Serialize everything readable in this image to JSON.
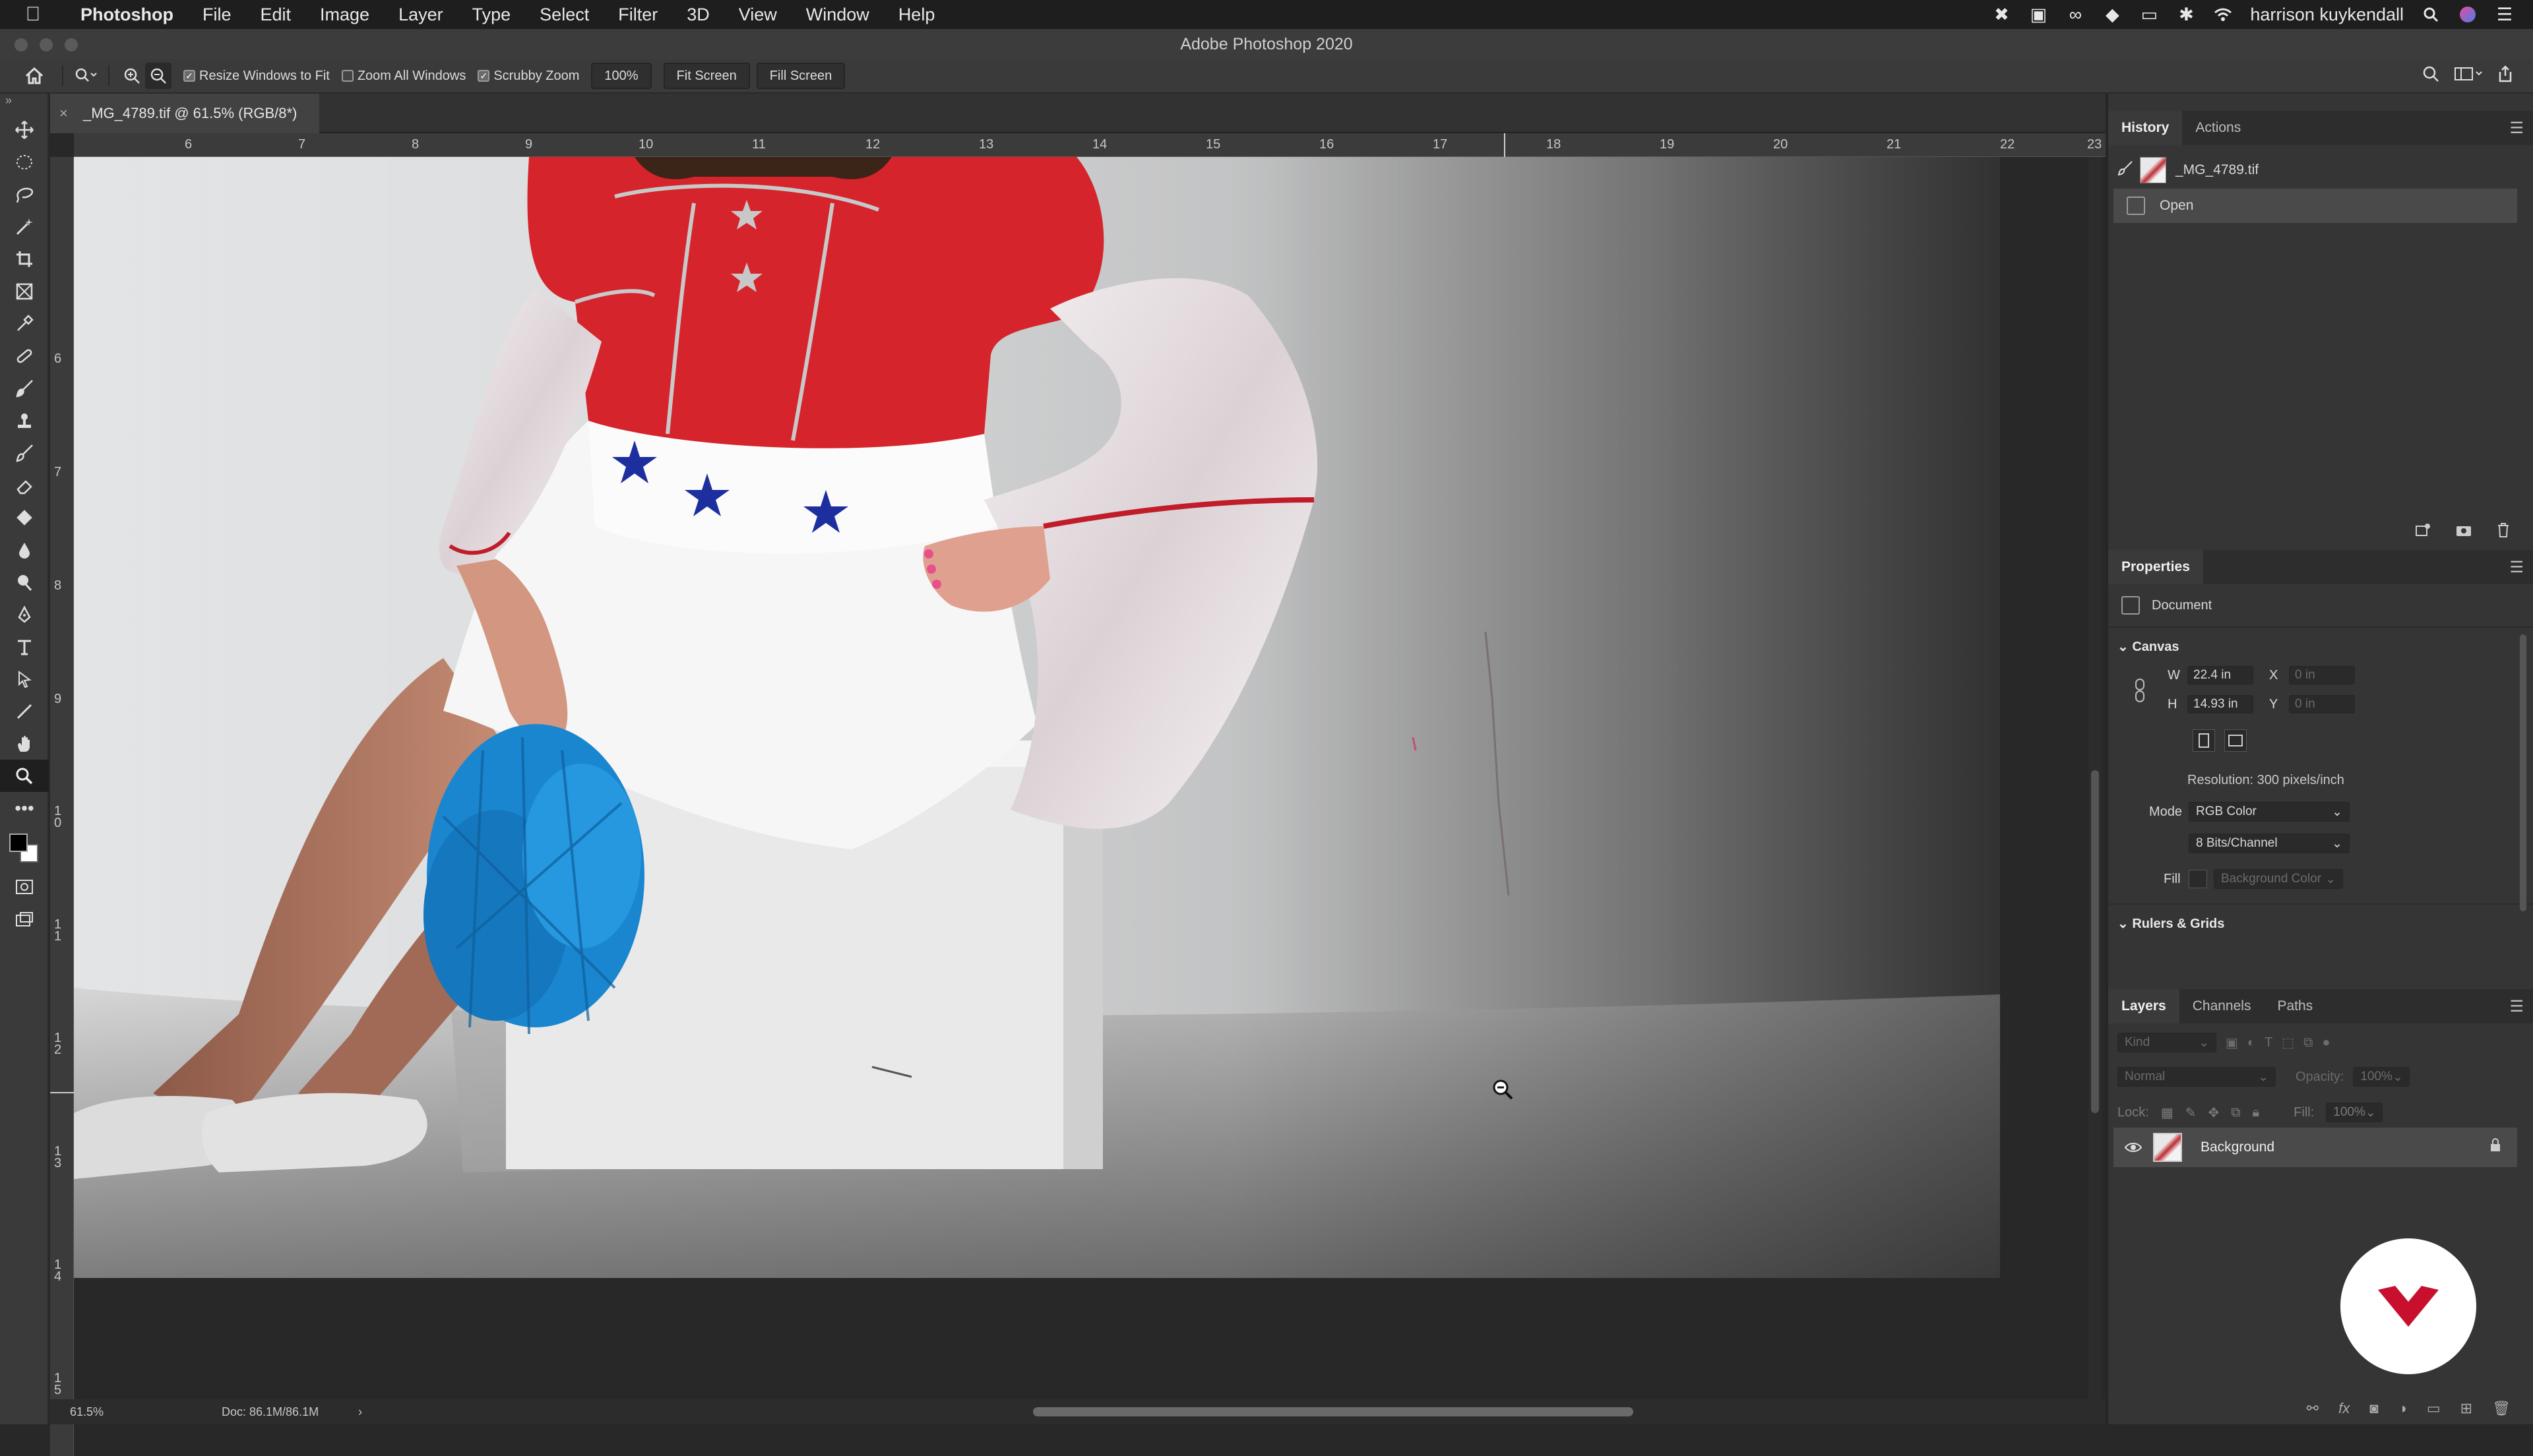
{
  "menubar": {
    "items": [
      "Photoshop",
      "File",
      "Edit",
      "Image",
      "Layer",
      "Type",
      "Select",
      "Filter",
      "3D",
      "View",
      "Window",
      "Help"
    ],
    "user": "harrison kuykendall"
  },
  "window": {
    "title": "Adobe Photoshop 2020"
  },
  "options": {
    "resize_windows": "Resize Windows to Fit",
    "zoom_all": "Zoom All Windows",
    "scrubby_zoom": "Scrubby Zoom",
    "zoom_value": "100%",
    "fit_screen": "Fit Screen",
    "fill_screen": "Fill Screen",
    "resize_checked": true,
    "zoom_all_checked": false,
    "scrubby_checked": true
  },
  "document": {
    "tab_title": "_MG_4789.tif @ 61.5% (RGB/8*)",
    "ruler_h": [
      "6",
      "7",
      "8",
      "9",
      "10",
      "11",
      "12",
      "13",
      "14",
      "15",
      "16",
      "17",
      "18",
      "19",
      "20",
      "21",
      "22",
      "23"
    ],
    "ruler_v": [
      "6",
      "7",
      "8",
      "9",
      "1 0",
      "1 1",
      "1 2",
      "1 3",
      "1 4",
      "1 5"
    ],
    "zoom": "61.5%",
    "doc_size": "Doc: 86.1M/86.1M"
  },
  "history": {
    "tabs": [
      "History",
      "Actions"
    ],
    "snapshot": "_MG_4789.tif",
    "steps": [
      "Open"
    ]
  },
  "properties": {
    "tab": "Properties",
    "type": "Document",
    "canvas_section": "Canvas",
    "w_label": "W",
    "w_value": "22.4 in",
    "h_label": "H",
    "h_value": "14.93 in",
    "x_label": "X",
    "x_value": "0 in",
    "y_label": "Y",
    "y_value": "0 in",
    "resolution": "Resolution: 300 pixels/inch",
    "mode_label": "Mode",
    "mode_value": "RGB Color",
    "bits_value": "8 Bits/Channel",
    "fill_label": "Fill",
    "fill_value": "Background Color",
    "rulers_section": "Rulers & Grids"
  },
  "layers": {
    "tabs": [
      "Layers",
      "Channels",
      "Paths"
    ],
    "filter_placeholder": "Kind",
    "blend_mode": "Normal",
    "opacity_label": "Opacity:",
    "opacity_value": "100%",
    "lock_label": "Lock:",
    "fill_label": "Fill:",
    "fill_value": "100%",
    "items": [
      {
        "name": "Background",
        "visible": true,
        "locked": true
      }
    ]
  },
  "colors": {
    "accent_red": "#c8102e",
    "photo_shirt": "#d7232c",
    "pompom": "#1a86d0"
  }
}
